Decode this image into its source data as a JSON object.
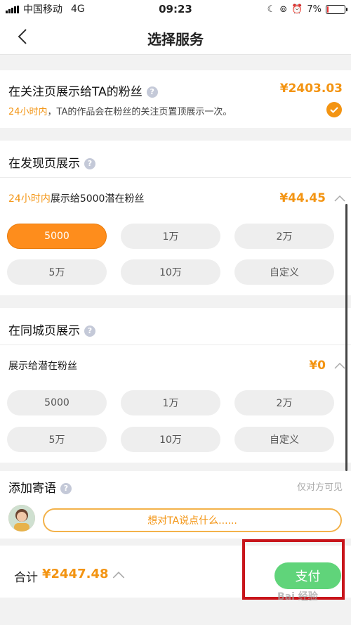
{
  "status_bar": {
    "carrier": "中国移动",
    "network": "4G",
    "time": "09:23",
    "battery": "7%",
    "battery_level": 0.07
  },
  "nav": {
    "title": "选择服务"
  },
  "follow_section": {
    "title": "在关注页展示给TA的粉丝",
    "price": "¥2403.03",
    "desc_highlight": "24小时内",
    "desc_rest": "，TA的作品会在粉丝的关注页置顶展示一次。",
    "selected": true
  },
  "discover_section": {
    "title": "在发现页展示",
    "sub_highlight": "24小时内",
    "sub_rest": "展示给5000潜在粉丝",
    "price": "¥44.45",
    "options": [
      "5000",
      "1万",
      "2万",
      "5万",
      "10万",
      "自定义"
    ],
    "selected_option": "5000"
  },
  "city_section": {
    "title": "在同城页展示",
    "sub": "展示给潜在粉丝",
    "price": "¥0",
    "options": [
      "5000",
      "1万",
      "2万",
      "5万",
      "10万",
      "自定义"
    ]
  },
  "message_section": {
    "title": "添加寄语",
    "note": "仅对方可见",
    "placeholder": "想对TA说点什么......"
  },
  "footer": {
    "total_label": "合计",
    "total_value": "¥2447.48",
    "pay_label": "支付"
  },
  "watermark": "Bai 经验",
  "colors": {
    "accent": "#f39412",
    "pill_active": "#fe8d1c",
    "pay": "#60d47a",
    "highlight_box": "#c8151b"
  },
  "icons": {
    "back": "chevron-left-icon",
    "help": "question-icon",
    "check": "check-circle-icon",
    "collapse": "chevron-up-icon"
  }
}
